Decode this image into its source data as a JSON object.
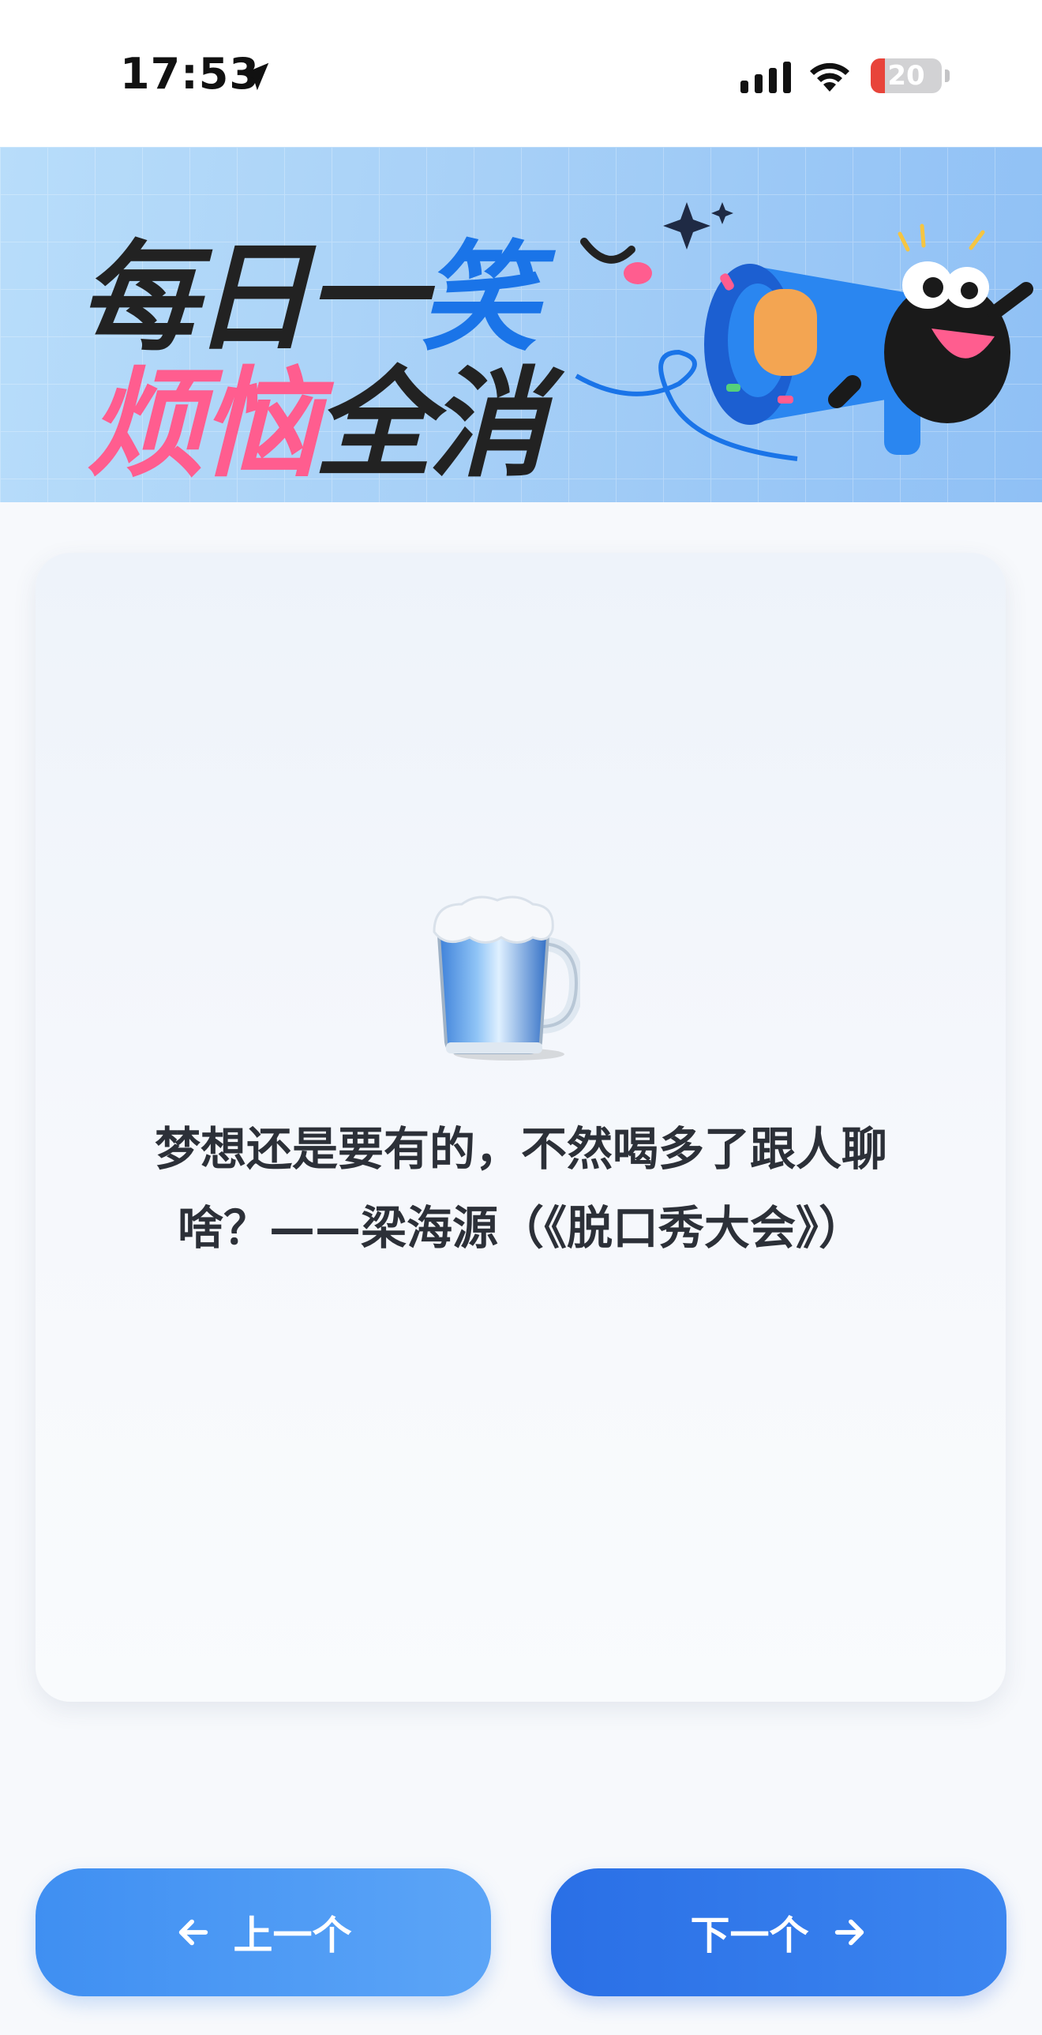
{
  "status_bar": {
    "time": "17:53",
    "battery_level": "20",
    "battery_color": "#e8443a"
  },
  "banner": {
    "line1_part1": "每日一",
    "line1_highlight": "笑",
    "line2_part1": "烦恼",
    "line2_part2": "全消"
  },
  "card": {
    "icon": "beer-mug-icon",
    "text": "梦想还是要有的，不然喝多了跟人聊啥？——梁海源（《脱口秀大会》）"
  },
  "nav": {
    "prev_label": "上一个",
    "next_label": "下一个"
  },
  "colors": {
    "accent_blue": "#2a6fe6",
    "pink": "#ff5d8f"
  }
}
